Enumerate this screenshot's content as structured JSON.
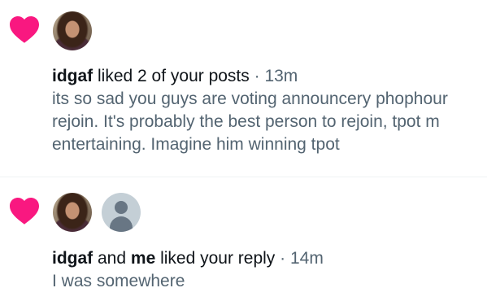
{
  "notifications": [
    {
      "actor": "idgaf",
      "action": " liked 2 of your posts",
      "separator": " · ",
      "time": "13m",
      "post_lines": [
        "its so sad you guys are voting announcery phophour",
        "rejoin. It's probably the best person to rejoin, tpot m",
        "entertaining. Imagine him winning tpot"
      ],
      "icon": "heart-icon",
      "avatars": [
        "user-photo-avatar"
      ]
    },
    {
      "actor": "idgaf",
      "conjunction": " and ",
      "actor2": "me",
      "action": " liked your reply",
      "separator": " · ",
      "time": "14m",
      "post_lines": [
        "I was somewhere"
      ],
      "icon": "heart-icon",
      "avatars": [
        "user-photo-avatar",
        "default-profile-avatar"
      ]
    }
  ],
  "colors": {
    "heart": "#f91880",
    "text_primary": "#0f1419",
    "text_secondary": "#536471",
    "divider": "#eff3f4",
    "default_avatar_bg": "#c4cfd6",
    "default_avatar_fg": "#687684"
  }
}
